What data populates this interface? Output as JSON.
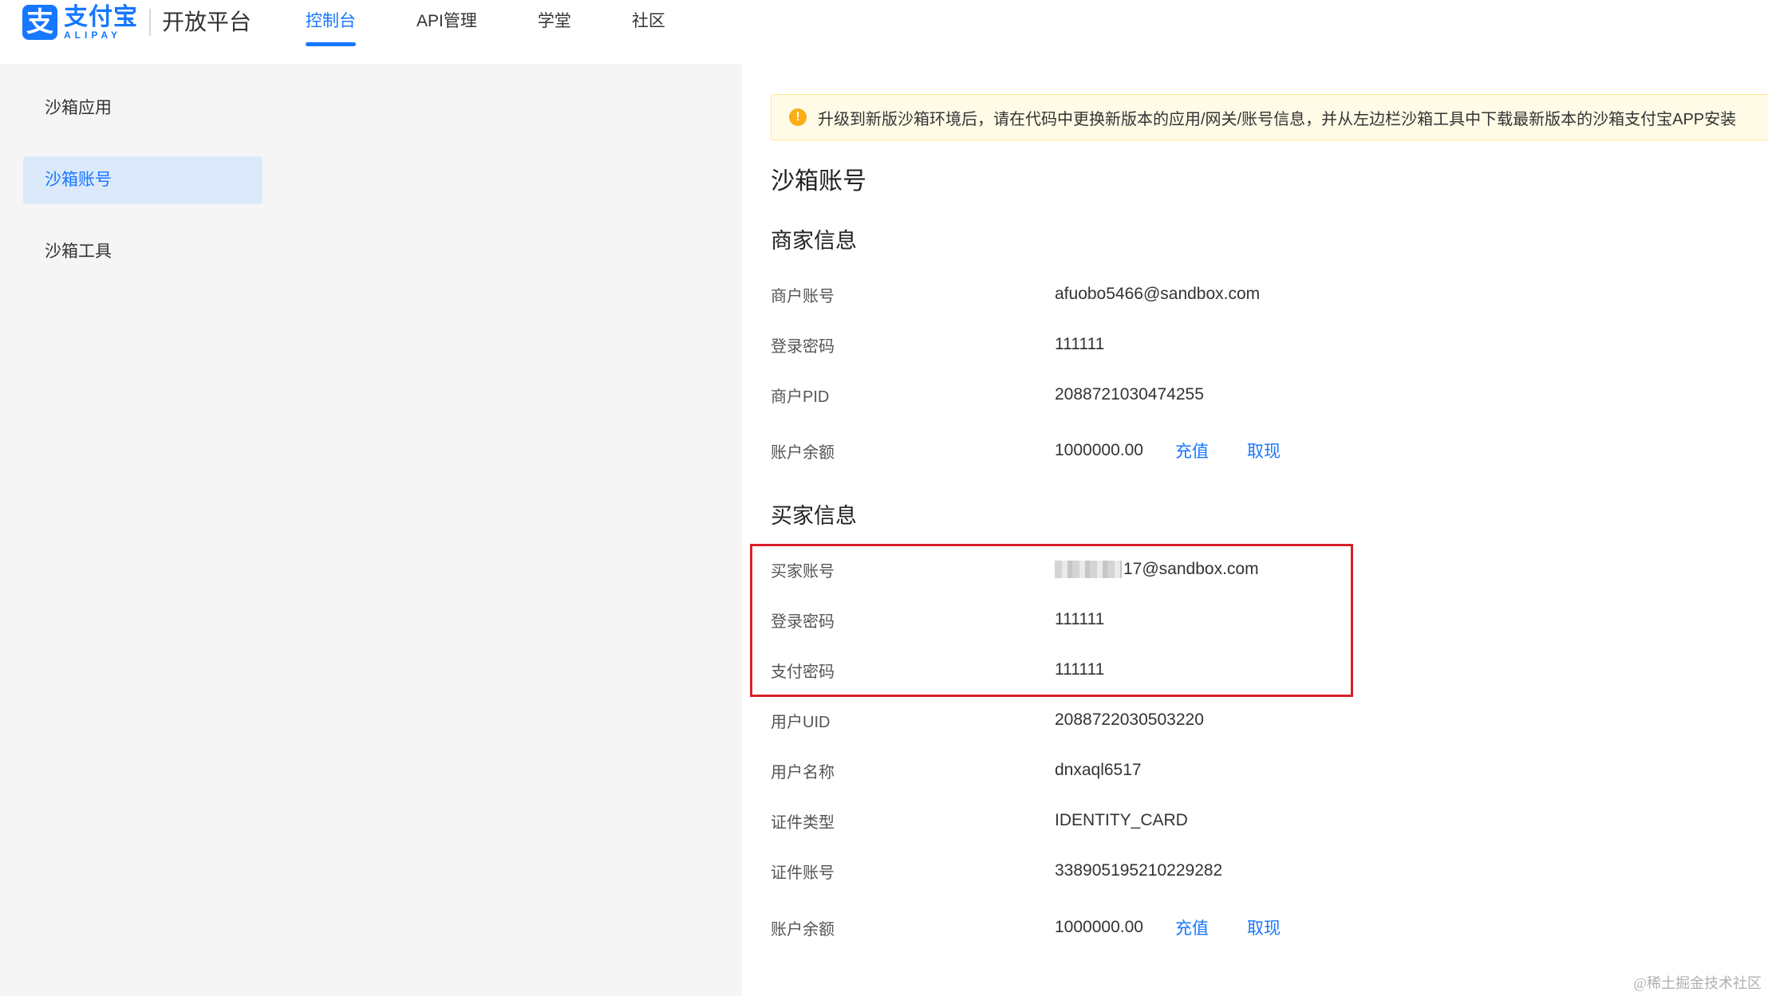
{
  "header": {
    "logo_cn": "支付宝",
    "logo_en": "ALIPAY",
    "logo_mark": "支",
    "platform_title": "开放平台",
    "nav": [
      {
        "label": "控制台",
        "active": true
      },
      {
        "label": "API管理",
        "active": false
      },
      {
        "label": "学堂",
        "active": false
      },
      {
        "label": "社区",
        "active": false
      }
    ]
  },
  "sidebar": {
    "items": [
      {
        "label": "沙箱应用",
        "active": false
      },
      {
        "label": "沙箱账号",
        "active": true
      },
      {
        "label": "沙箱工具",
        "active": false
      }
    ]
  },
  "alert": {
    "icon": "warning-icon",
    "glyph": "!",
    "text": "升级到新版沙箱环境后，请在代码中更换新版本的应用/网关/账号信息，并从左边栏沙箱工具中下载最新版本的沙箱支付宝APP安装"
  },
  "page_title": "沙箱账号",
  "merchant": {
    "title": "商家信息",
    "rows": [
      {
        "label": "商户账号",
        "value": "afuobo5466@sandbox.com"
      },
      {
        "label": "登录密码",
        "value": "111111"
      },
      {
        "label": "商户PID",
        "value": "2088721030474255"
      },
      {
        "label": "账户余额",
        "value": "1000000.00",
        "recharge": "充值",
        "withdraw": "取现"
      }
    ]
  },
  "buyer": {
    "title": "买家信息",
    "account_label": "买家账号",
    "account_value": "17@sandbox.com",
    "rows": [
      {
        "label": "登录密码",
        "value": "111111"
      },
      {
        "label": "支付密码",
        "value": "111111"
      },
      {
        "label": "用户UID",
        "value": "2088722030503220"
      },
      {
        "label": "用户名称",
        "value": "dnxaql6517"
      },
      {
        "label": "证件类型",
        "value": "IDENTITY_CARD"
      },
      {
        "label": "证件账号",
        "value": "338905195210229282"
      },
      {
        "label": "账户余额",
        "value": "1000000.00",
        "recharge": "充值",
        "withdraw": "取现"
      }
    ]
  },
  "colors": {
    "accent": "#1677ff",
    "highlight_border": "#d9202b",
    "alert_bg": "#fffbe6"
  },
  "watermark": "@稀土掘金技术社区"
}
